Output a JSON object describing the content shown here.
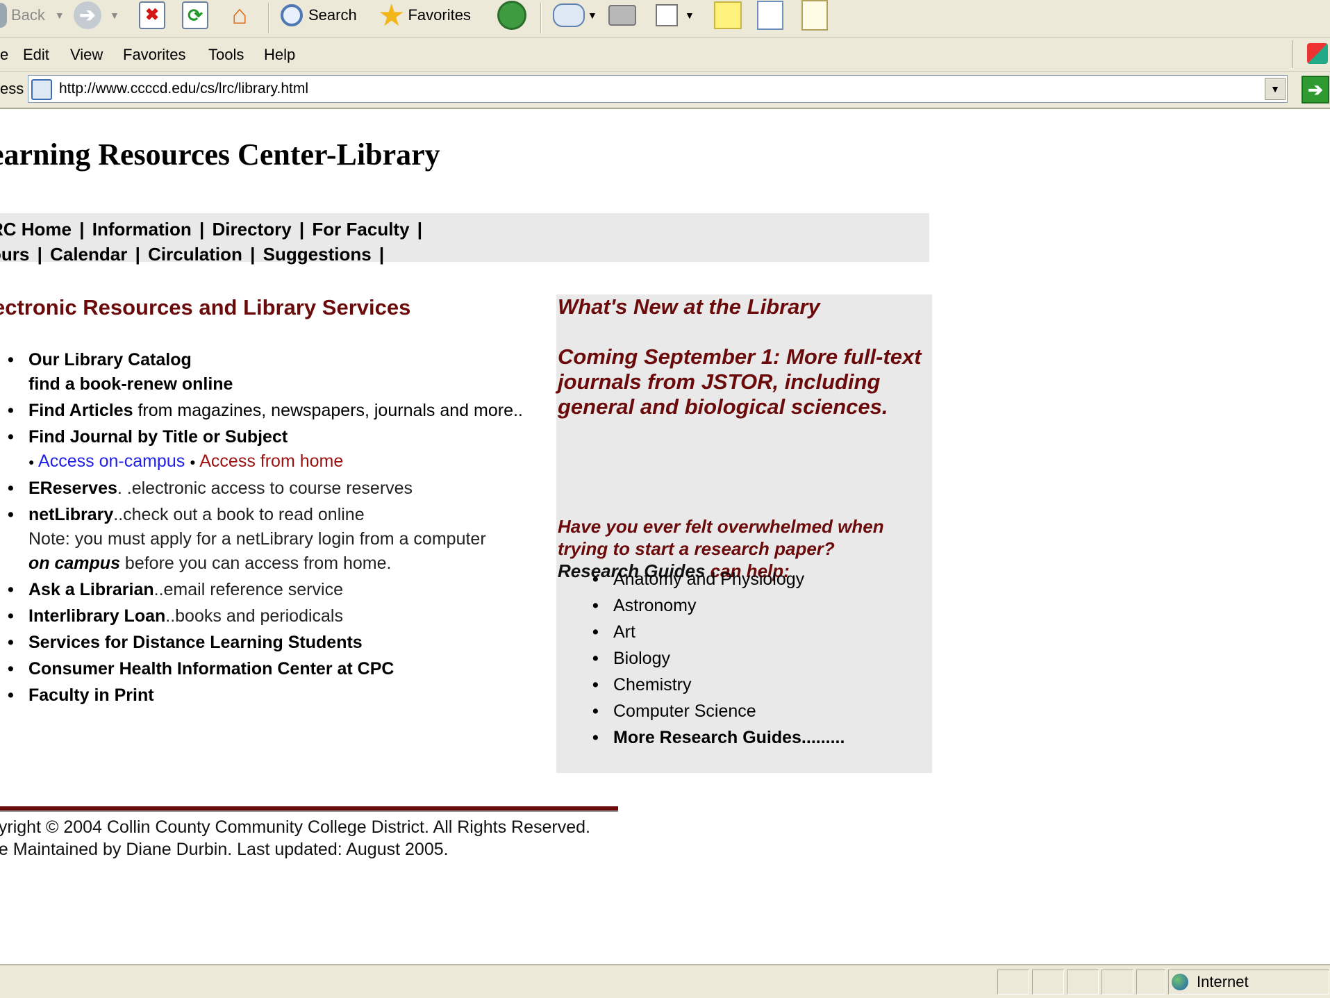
{
  "browser": {
    "toolbar": {
      "back_label": "Back",
      "search_label": "Search",
      "favorites_label": "Favorites"
    },
    "menu": [
      "Edit",
      "View",
      "Favorites",
      "Tools",
      "Help"
    ],
    "menu_partial": "e",
    "address": {
      "label": "ess",
      "url": "http://www.ccccd.edu/cs/lrc/library.html"
    },
    "status": {
      "zone": "Internet"
    }
  },
  "page": {
    "title": "earning Resources Center-Library",
    "nav": {
      "line1": [
        "RC Home",
        "Information",
        "Directory",
        "For Faculty"
      ],
      "line2": [
        "ours",
        "Calendar",
        "Circulation",
        "Suggestions"
      ],
      "separator": "|"
    },
    "electronic": {
      "heading": "ectronic Resources and Library Services",
      "catalog_title": "Our Library Catalog",
      "catalog_sub": "find a book-renew online",
      "articles_title": "Find Articles",
      "articles_desc": " from magazines, newspapers, journals and more..",
      "journal_title": "Find Journal by Title or Subject",
      "access_campus": "Access on-campus",
      "access_home": "Access from home",
      "ereserves_title": "EReserves",
      "ereserves_desc": ". .electronic access to course reserves",
      "netlib_title": "netLibrary",
      "netlib_desc": "..check out a book to read online",
      "netlib_note1": "Note: you must apply for a netLibrary login from a computer",
      "netlib_note_em": "on campus",
      "netlib_note2": " before you can access from home.",
      "ask_title": "Ask a Librarian",
      "ask_desc": "..email reference service",
      "ill_title": "Interlibrary Loan",
      "ill_desc": "..books and periodicals",
      "distance_title": "Services for Distance Learning Students",
      "health_title": "Consumer Health Information Center at CPC",
      "faculty_title": "Faculty in Print"
    },
    "news": {
      "heading": "What's New at the Library",
      "announcement": "Coming September 1: More full-text journals from JSTOR, including general and biological sciences.",
      "question": "Have you ever felt overwhelmed when trying to start a research paper?",
      "guides_label": "Research Guides",
      "guides_suffix": " can help:",
      "guides": [
        "Anatomy and Physiology",
        "Astronomy",
        "Art",
        "Biology",
        "Chemistry",
        "Computer Science"
      ],
      "more_guides": "More Research Guides........."
    },
    "footer": {
      "copyright": "pyright © 2004 Collin County Community College District. All Rights Reserved.",
      "maintained": "ge Maintained by Diane Durbin. Last updated: August 2005."
    }
  }
}
